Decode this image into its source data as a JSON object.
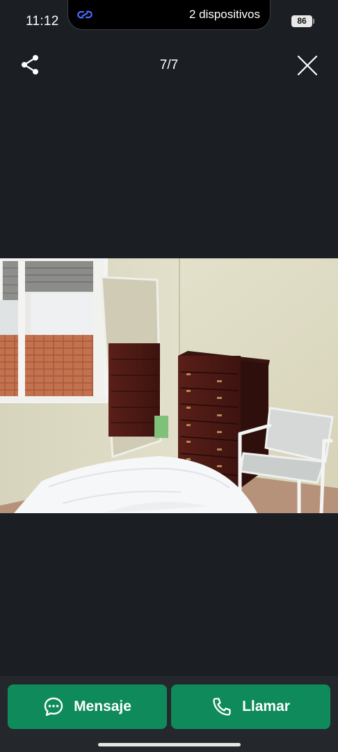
{
  "status_bar": {
    "time": "11:12",
    "island_text": "2 dispositivos",
    "battery": "86"
  },
  "toolbar": {
    "counter": "7/7"
  },
  "actions": {
    "message_label": "Mensaje",
    "call_label": "Llamar"
  },
  "colors": {
    "background": "#1b1f23",
    "bottom_bar": "#24282c",
    "button": "#0f8a5a",
    "link_icon": "#4a6cff"
  },
  "icons": {
    "share": "share-icon",
    "close": "close-icon",
    "message": "chat-bubble-icon",
    "call": "phone-icon",
    "link": "link-icon"
  }
}
